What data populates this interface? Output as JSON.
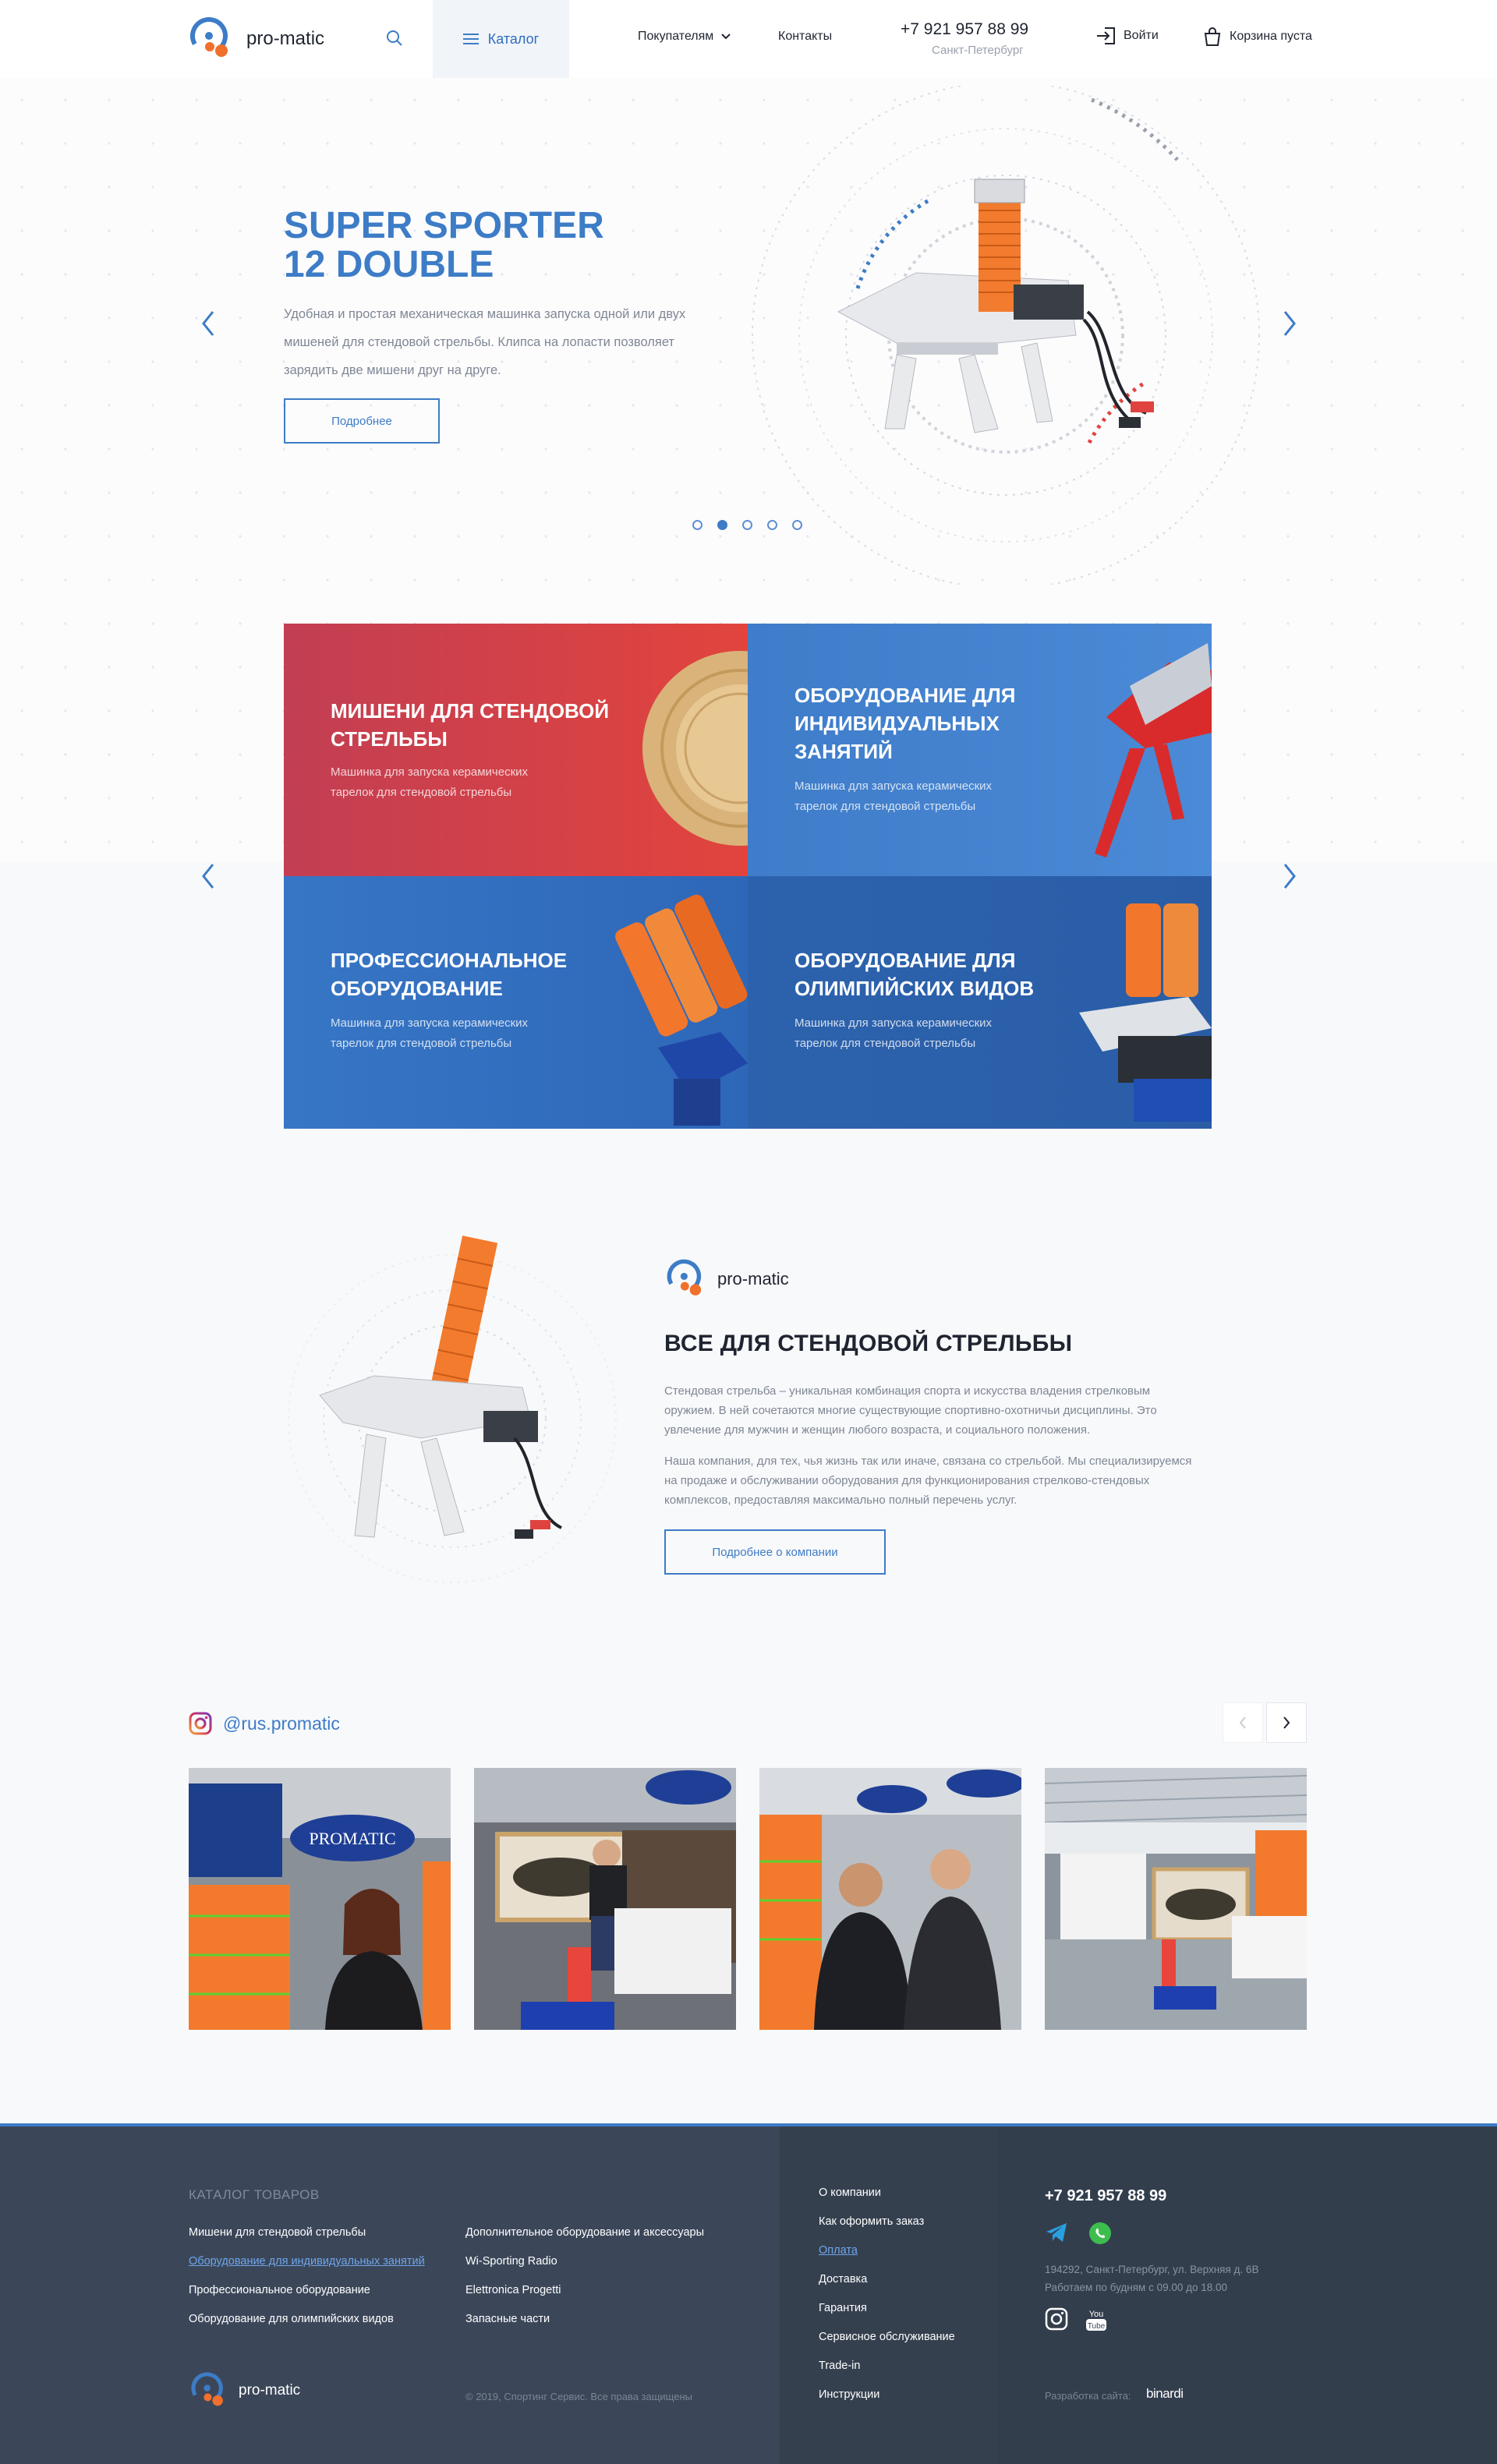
{
  "header": {
    "logo_text": "pro-matic",
    "catalog_label": "Каталог",
    "nav_buyers": "Покупателям",
    "nav_contacts": "Контакты",
    "phone": "+7 921 957 88 99",
    "city": "Санкт-Петербург",
    "login_label": "Войти",
    "cart_label": "Корзина пуста"
  },
  "hero": {
    "title_line1": "SUPER SPORTER",
    "title_line2": "12 DOUBLE",
    "description": "Удобная и простая механическая машинка запуска одной или двух мишеней для стендовой стрельбы. Клипса на лопасти позволяет зарядить две мишени друг на друге.",
    "button_label": "Подробнее",
    "slides_total": 5,
    "active_slide": 2
  },
  "categories": [
    {
      "title": "МИШЕНИ ДЛЯ СТЕНДОВОЙ СТРЕЛЬБЫ",
      "subtitle": "Машинка для запуска керамических тарелок для стендовой стрельбы"
    },
    {
      "title": "ОБОРУДОВАНИЕ ДЛЯ ИНДИВИДУАЛЬНЫХ ЗАНЯТИЙ",
      "subtitle": "Машинка для запуска керамических тарелок для стендовой стрельбы"
    },
    {
      "title": "ПРОФЕССИОНАЛЬНОЕ ОБОРУДОВАНИЕ",
      "subtitle": "Машинка для запуска керамических тарелок для стендовой стрельбы"
    },
    {
      "title": "ОБОРУДОВАНИЕ ДЛЯ ОЛИМПИЙСКИХ ВИДОВ",
      "subtitle": "Машинка для запуска керамических тарелок для стендовой стрельбы"
    }
  ],
  "about": {
    "logo_text": "pro-matic",
    "title": "ВСЕ ДЛЯ СТЕНДОВОЙ СТРЕЛЬБЫ",
    "paragraph1": "Стендовая стрельба – уникальная комбинация спорта и искусства владения стрелковым оружием. В ней сочетаются многие существующие спортивно-охотничьи дисциплины. Это увлечение для мужчин и женщин любого возраста, и социального положения.",
    "paragraph2": "Наша компания, для тех, чья жизнь так или иначе, связана со стрельбой. Мы специализируемся на продаже и обслуживании оборудования для функционирования стрелково-стендовых комплексов, предоставляя максимально полный перечень услуг.",
    "button_label": "Подробнее о компании"
  },
  "instagram": {
    "handle": "@rus.promatic",
    "booth_sign": "PROMATIC"
  },
  "footer": {
    "catalog_title": "КАТАЛОГ ТОВАРОВ",
    "catalog_col1": [
      "Мишени для стендовой стрельбы",
      "Оборудование для индивидуальных занятий",
      "Профессиональное оборудование",
      "Оборудование для олимпийских видов"
    ],
    "catalog_col2": [
      "Дополнительное оборудование и аксессуары",
      "Wi-Sporting Radio",
      "Elettronica Progetti",
      "Запасные части"
    ],
    "info_links": [
      "О компании",
      "Как оформить заказ",
      "Оплата",
      "Доставка",
      "Гарантия",
      "Сервисное обслуживание",
      "Trade-in",
      "Инструкции"
    ],
    "phone": "+7 921 957 88 99",
    "address": "194292, Санкт-Петербург, ул. Верхняя д. 6В",
    "hours": "Работаем по будням с 09.00 до 18.00",
    "logo_text": "pro-matic",
    "copyright": "© 2019, Спортинг Сервис. Все права защищены",
    "developer_label": "Разработка сайта:",
    "developer_name": "binardi",
    "youtube_label_top": "You",
    "youtube_label_bottom": "Tube"
  },
  "colors": {
    "accent": "#3d7cc6",
    "orange": "#f0702c",
    "footer_bg": "#3b4759"
  },
  "icons": [
    "search-icon",
    "menu-icon",
    "chevron-down-icon",
    "login-icon",
    "cart-icon",
    "chevron-left-icon",
    "chevron-right-icon",
    "instagram-icon",
    "telegram-icon",
    "whatsapp-icon",
    "youtube-icon"
  ]
}
